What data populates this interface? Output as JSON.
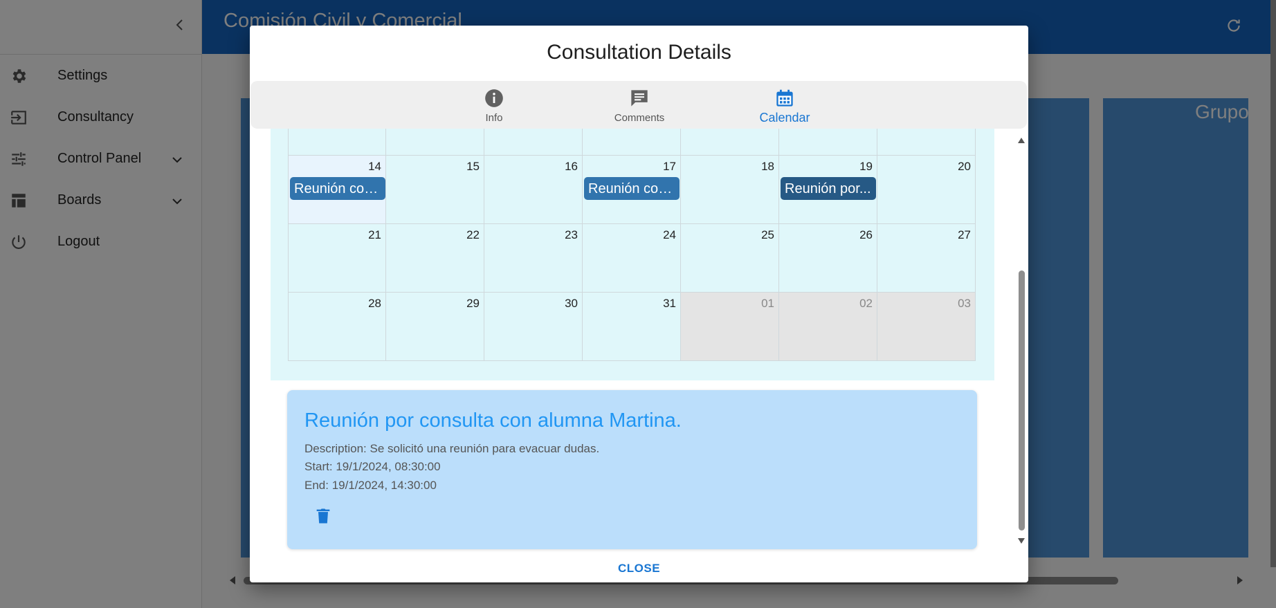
{
  "sidebar": {
    "items": [
      {
        "label": "Settings",
        "icon": "gear-icon"
      },
      {
        "label": "Consultancy",
        "icon": "login-icon"
      },
      {
        "label": "Control Panel",
        "icon": "tune-icon"
      },
      {
        "label": "Boards",
        "icon": "table-icon"
      },
      {
        "label": "Logout",
        "icon": "power-icon"
      }
    ]
  },
  "appbar": {
    "title": "Comisión Civil y Comercial"
  },
  "board": {
    "card_title": "Grupo"
  },
  "dialog": {
    "title": "Consultation Details",
    "tabs": [
      {
        "label": "Info",
        "icon": "info-icon"
      },
      {
        "label": "Comments",
        "icon": "comment-icon"
      },
      {
        "label": "Calendar",
        "icon": "calendar-icon",
        "active": true
      }
    ],
    "calendar": {
      "weeks": [
        [
          "14",
          "15",
          "16",
          "17",
          "18",
          "19",
          "20"
        ],
        [
          "21",
          "22",
          "23",
          "24",
          "25",
          "26",
          "27"
        ],
        [
          "28",
          "29",
          "30",
          "31",
          "01",
          "02",
          "03"
        ]
      ],
      "events": [
        {
          "day": "14",
          "label": "Reunión con..."
        },
        {
          "day": "17",
          "label": "Reunión con..."
        },
        {
          "day": "19",
          "label": "Reunión por..."
        }
      ]
    },
    "detail": {
      "title": "Reunión por consulta con alumna Martina.",
      "description": "Description: Se solicitó una reunión para evacuar dudas.",
      "start": "Start: 19/1/2024, 08:30:00",
      "end": "End: 19/1/2024, 14:30:00"
    },
    "close_label": "CLOSE"
  },
  "colors": {
    "primary": "#1565c0",
    "event": "#3174ad",
    "event_selected": "#265985",
    "calendar_bg": "#e0f7fa",
    "detail_bg": "#bbdefb",
    "detail_title": "#2196f3"
  }
}
